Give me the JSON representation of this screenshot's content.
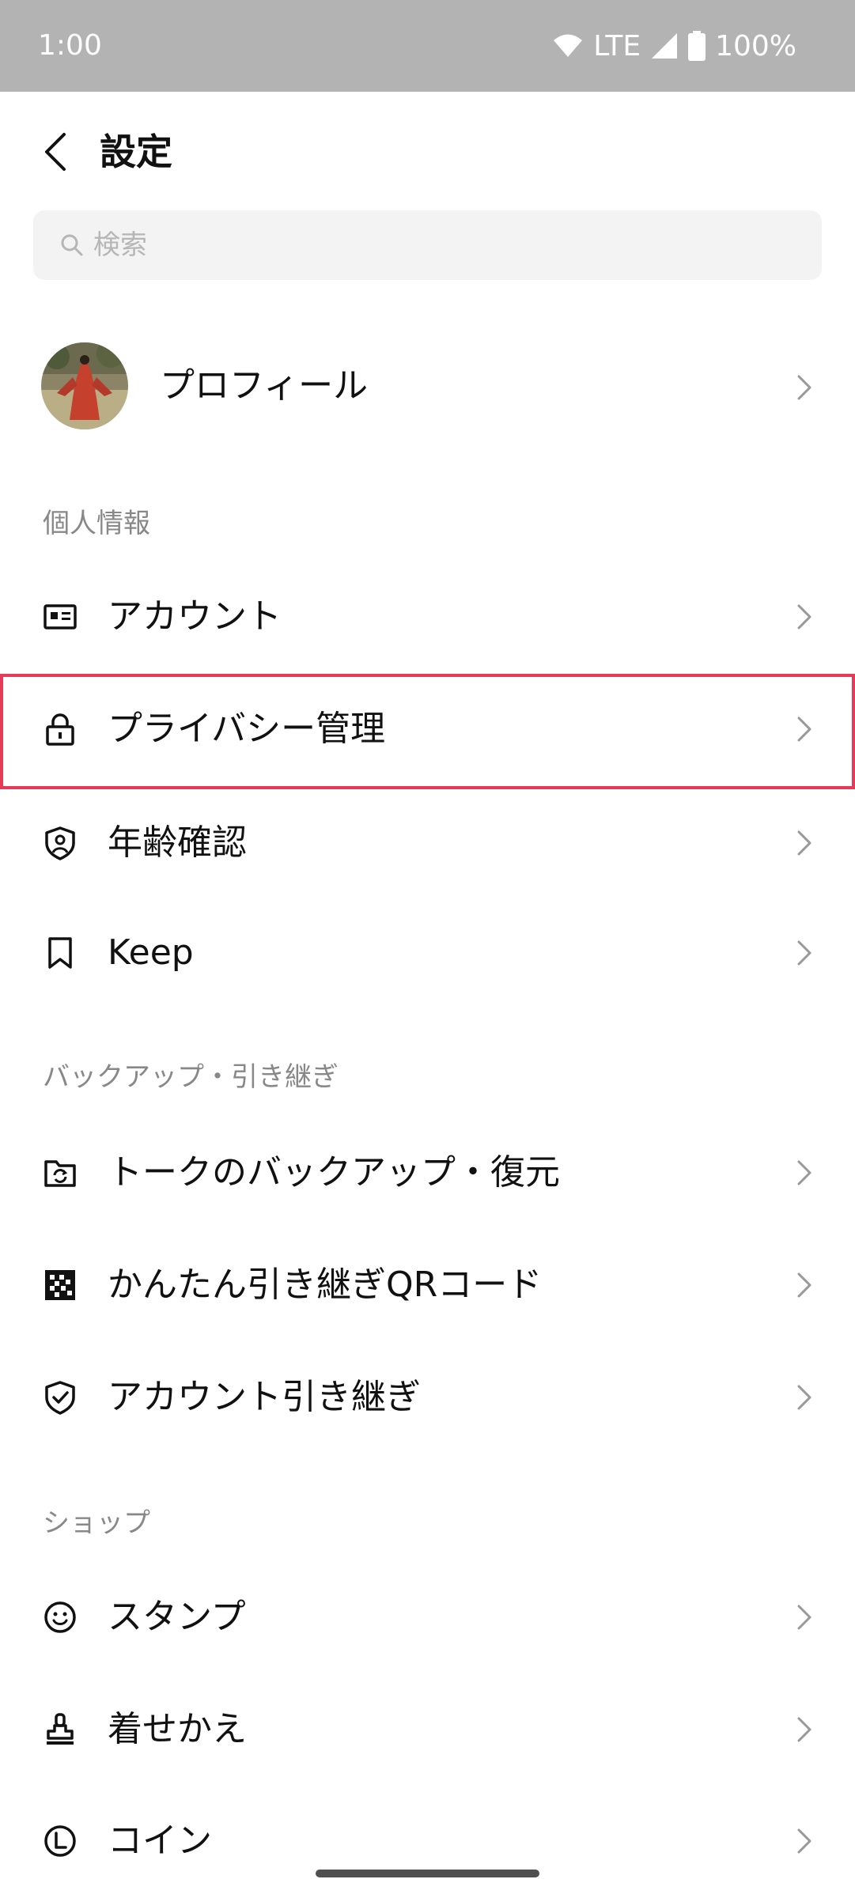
{
  "status_bar": {
    "time": "1:00",
    "network": "LTE",
    "battery": "100%"
  },
  "header": {
    "title": "設定"
  },
  "search": {
    "placeholder": "検索"
  },
  "profile": {
    "label": "プロフィール"
  },
  "sections": {
    "personal": {
      "title": "個人情報",
      "items": [
        {
          "label": "アカウント",
          "icon": "id-card-icon"
        },
        {
          "label": "プライバシー管理",
          "icon": "lock-icon",
          "highlighted": true
        },
        {
          "label": "年齢確認",
          "icon": "shield-user-icon"
        },
        {
          "label": "Keep",
          "icon": "bookmark-icon"
        }
      ]
    },
    "backup": {
      "title": "バックアップ・引き継ぎ",
      "items": [
        {
          "label": "トークのバックアップ・復元",
          "icon": "folder-sync-icon"
        },
        {
          "label": "かんたん引き継ぎQRコード",
          "icon": "qr-code-icon"
        },
        {
          "label": "アカウント引き継ぎ",
          "icon": "shield-check-icon"
        }
      ]
    },
    "shop": {
      "title": "ショップ",
      "items": [
        {
          "label": "スタンプ",
          "icon": "smiley-icon"
        },
        {
          "label": "着せかえ",
          "icon": "stamp-icon"
        },
        {
          "label": "コイン",
          "icon": "coin-icon"
        }
      ]
    }
  },
  "colors": {
    "highlight": "#e63a59",
    "status_bar": "#b3b3b3",
    "section_title": "#888888"
  }
}
